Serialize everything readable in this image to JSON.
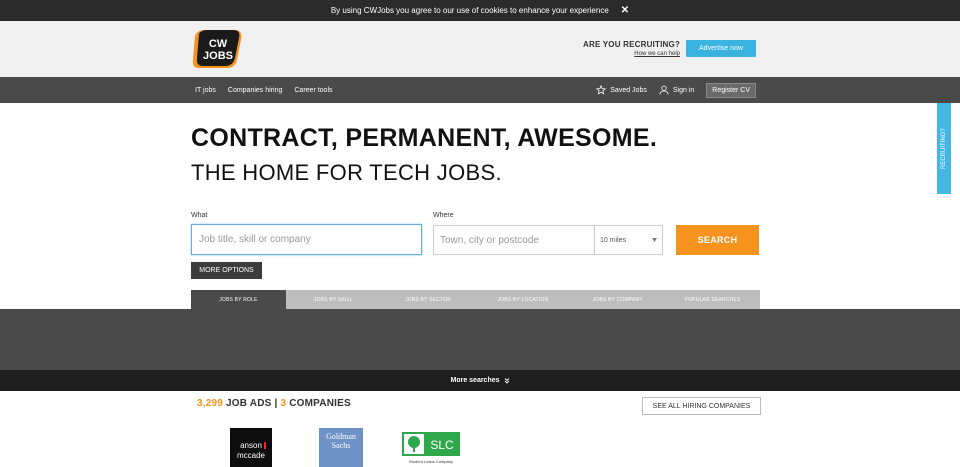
{
  "cookie": {
    "message": "By using CWJobs you agree to our use of cookies to enhance your experience",
    "close": "✕"
  },
  "header": {
    "logo_text_top": "CW",
    "logo_text_bottom": "JOBS",
    "recruiting_question": "ARE YOU RECRUITING?",
    "recruiting_link": "How we can help",
    "advertise_label": "Advertise now"
  },
  "nav": {
    "left": [
      "IT jobs",
      "Companies hiring",
      "Career tools"
    ],
    "saved_jobs": "Saved Jobs",
    "sign_in": "Sign in",
    "register_cv": "Register CV"
  },
  "side_tab": "RECRUITING?",
  "hero": {
    "title": "CONTRACT, PERMANENT, AWESOME.",
    "subtitle": "THE HOME FOR TECH JOBS."
  },
  "search": {
    "what_label": "What",
    "what_placeholder": "Job title, skill or company",
    "where_label": "Where",
    "where_placeholder": "Town, city or postcode",
    "radius": "10 miles",
    "search_label": "SEARCH",
    "more_options": "MORE OPTIONS"
  },
  "tabs": [
    "JOBS BY ROLE",
    "JOBS BY SKILL",
    "JOBS BY SECTOR",
    "JOBS BY LOCATION",
    "JOBS BY COMPANY",
    "POPULAR SEARCHES"
  ],
  "more_searches": "More searches",
  "stats": {
    "jobs_count": "3,299",
    "jobs_label": "JOB ADS",
    "separator": "|",
    "companies_count": "3",
    "companies_label": "COMPANIES"
  },
  "see_all": "SEE ALL HIRING COMPANIES",
  "companies": {
    "anson_top": "anson",
    "anson_bottom": "mccade",
    "goldman_top": "Goldman",
    "goldman_bottom": "Sachs",
    "slc": "SLC",
    "slc_caption": "Student Loans Company"
  },
  "colors": {
    "accent_orange": "#f6921e",
    "accent_blue": "#3ab3e0",
    "nav_dark": "#4a4a4a"
  }
}
